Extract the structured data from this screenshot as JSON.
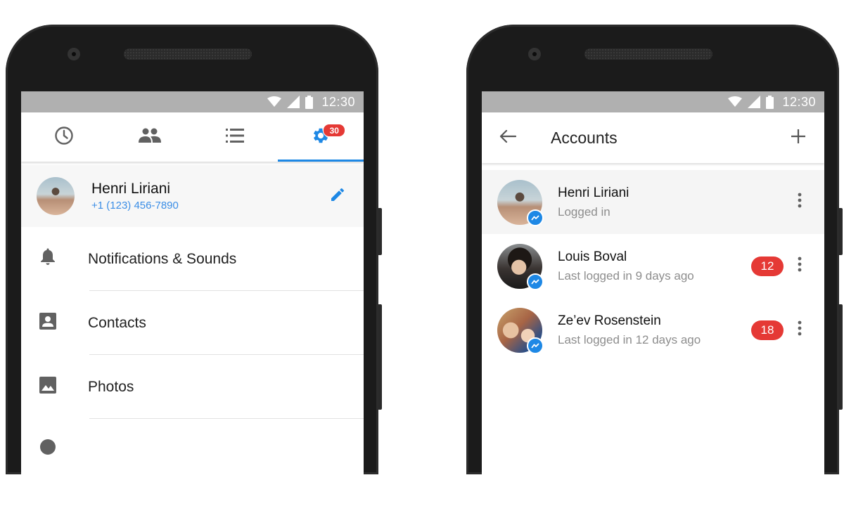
{
  "status_bar": {
    "time": "12:30",
    "icons": [
      "wifi-icon",
      "signal-icon",
      "battery-icon"
    ]
  },
  "settings_screen": {
    "tabs": [
      {
        "name": "recent",
        "icon": "clock-icon",
        "active": false
      },
      {
        "name": "people",
        "icon": "people-icon",
        "active": false
      },
      {
        "name": "lists",
        "icon": "list-icon",
        "active": false
      },
      {
        "name": "settings",
        "icon": "gear-icon",
        "active": true,
        "badge": "30"
      }
    ],
    "profile": {
      "name": "Henri Liriani",
      "phone": "+1 (123) 456-7890",
      "edit_icon": "pencil-icon"
    },
    "menu": [
      {
        "label": "Notifications & Sounds",
        "icon": "bell-icon"
      },
      {
        "label": "Contacts",
        "icon": "contact-card-icon"
      },
      {
        "label": "Photos",
        "icon": "photo-icon"
      }
    ]
  },
  "accounts_screen": {
    "title": "Accounts",
    "back_icon": "arrow-left-icon",
    "add_icon": "plus-icon",
    "accounts": [
      {
        "name": "Henri Liriani",
        "status": "Logged in",
        "badge": null,
        "current": true
      },
      {
        "name": "Louis Boval",
        "status": "Last logged in 9 days ago",
        "badge": "12",
        "current": false
      },
      {
        "name": "Ze’ev Rosenstein",
        "status": "Last logged in 12 days ago",
        "badge": "18",
        "current": false
      }
    ]
  },
  "colors": {
    "accent": "#1e88e5",
    "badge": "#e53935",
    "status_bar": "#b0b0b0",
    "icon_gray": "#616161"
  }
}
